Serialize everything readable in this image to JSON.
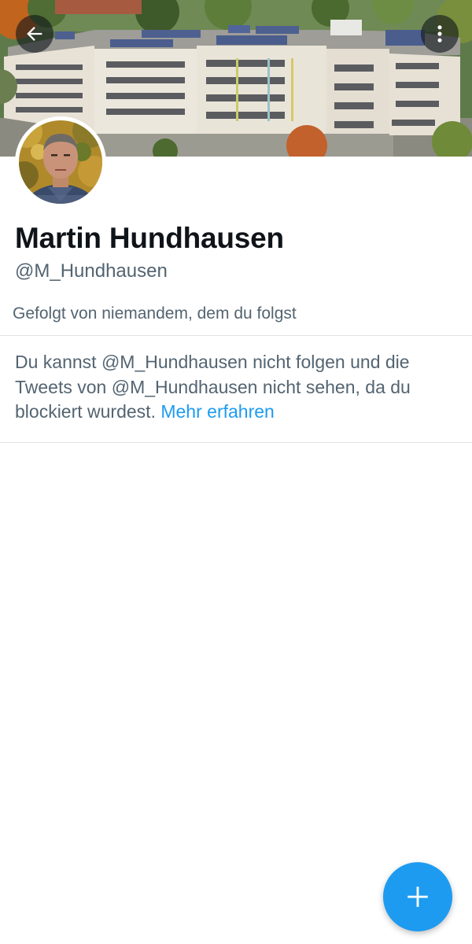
{
  "header": {
    "back_icon": "arrow-left-icon",
    "more_icon": "more-vertical-icon",
    "banner_description": "aerial photo of a school building with solar panels"
  },
  "profile": {
    "display_name": "Martin Hundhausen",
    "handle": "@M_Hundhausen",
    "followed_by": "Gefolgt von niemandem, dem du folgst"
  },
  "blocked": {
    "message": "Du kannst @M_Hundhausen nicht folgen und die Tweets von @M_Hundhausen nicht sehen, da du blockiert wurdest.",
    "learn_more": "Mehr erfahren"
  },
  "fab": {
    "icon": "plus-icon"
  },
  "colors": {
    "accent": "#1d9bf0",
    "text_primary": "#0f1419",
    "text_secondary": "#536471",
    "divider": "#e1e5e8"
  }
}
